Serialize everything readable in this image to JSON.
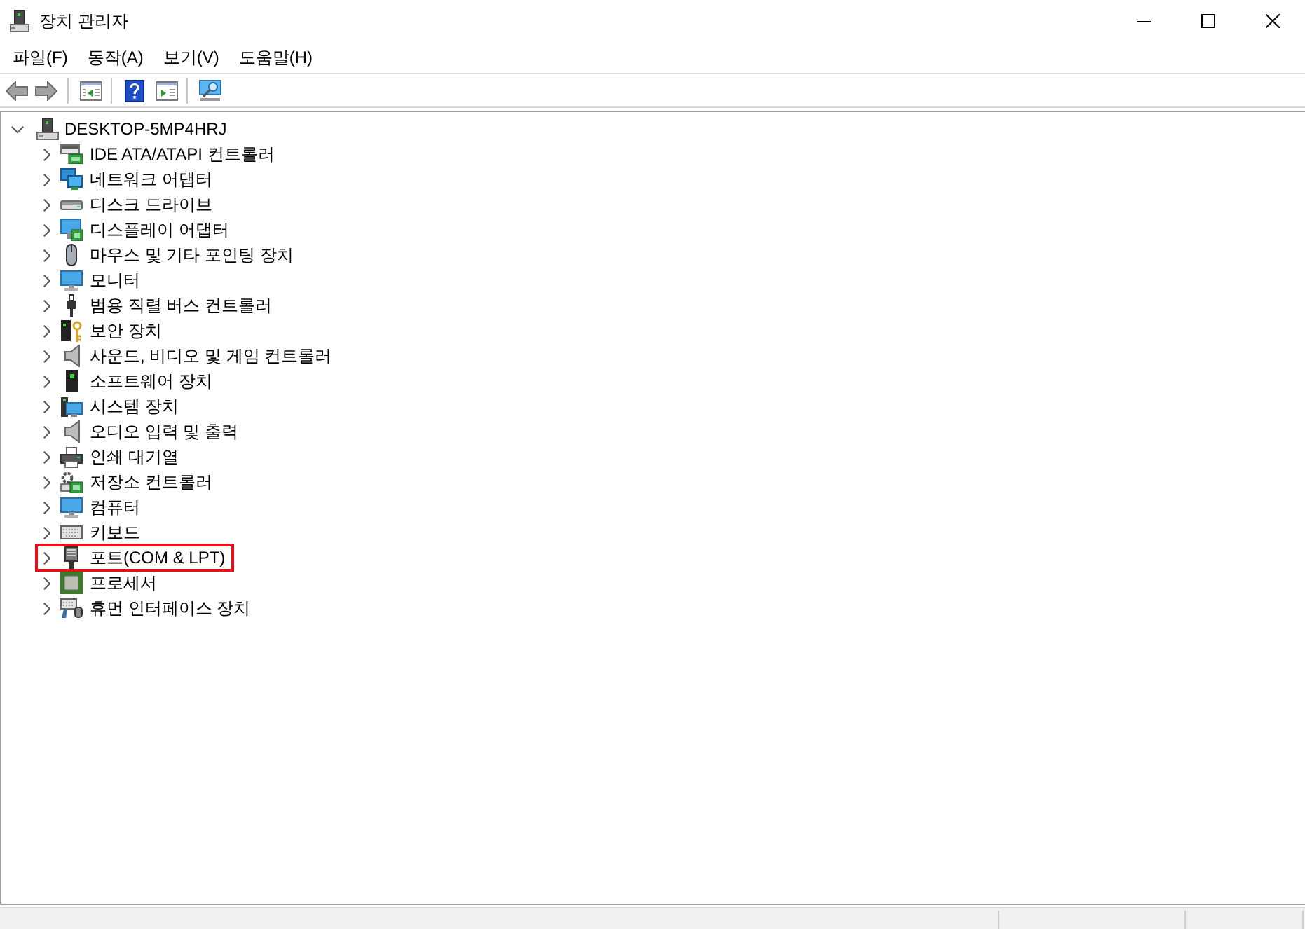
{
  "window": {
    "title": "장치 관리자"
  },
  "menu": [
    "파일(F)",
    "동작(A)",
    "보기(V)",
    "도움말(H)"
  ],
  "tree": {
    "label": "DESKTOP-5MP4HRJ",
    "expanded": true,
    "children": [
      {
        "label": "IDE ATA/ATAPI 컨트롤러",
        "expanded": false,
        "highlighted": false
      },
      {
        "label": "네트워크 어댑터",
        "expanded": false,
        "highlighted": false
      },
      {
        "label": "디스크 드라이브",
        "expanded": false,
        "highlighted": false
      },
      {
        "label": "디스플레이 어댑터",
        "expanded": false,
        "highlighted": false
      },
      {
        "label": "마우스 및 기타 포인팅 장치",
        "expanded": false,
        "highlighted": false
      },
      {
        "label": "모니터",
        "expanded": false,
        "highlighted": false
      },
      {
        "label": "범용 직렬 버스 컨트롤러",
        "expanded": false,
        "highlighted": false
      },
      {
        "label": "보안 장치",
        "expanded": false,
        "highlighted": false
      },
      {
        "label": "사운드, 비디오 및 게임 컨트롤러",
        "expanded": false,
        "highlighted": false
      },
      {
        "label": "소프트웨어 장치",
        "expanded": false,
        "highlighted": false
      },
      {
        "label": "시스템 장치",
        "expanded": false,
        "highlighted": false
      },
      {
        "label": "오디오 입력 및 출력",
        "expanded": false,
        "highlighted": false
      },
      {
        "label": "인쇄 대기열",
        "expanded": false,
        "highlighted": false
      },
      {
        "label": "저장소 컨트롤러",
        "expanded": false,
        "highlighted": false
      },
      {
        "label": "컴퓨터",
        "expanded": false,
        "highlighted": false
      },
      {
        "label": "키보드",
        "expanded": false,
        "highlighted": false
      },
      {
        "label": "포트(COM & LPT)",
        "expanded": false,
        "highlighted": true
      },
      {
        "label": "프로세서",
        "expanded": false,
        "highlighted": false
      },
      {
        "label": "휴먼 인터페이스 장치",
        "expanded": false,
        "highlighted": false
      }
    ]
  }
}
